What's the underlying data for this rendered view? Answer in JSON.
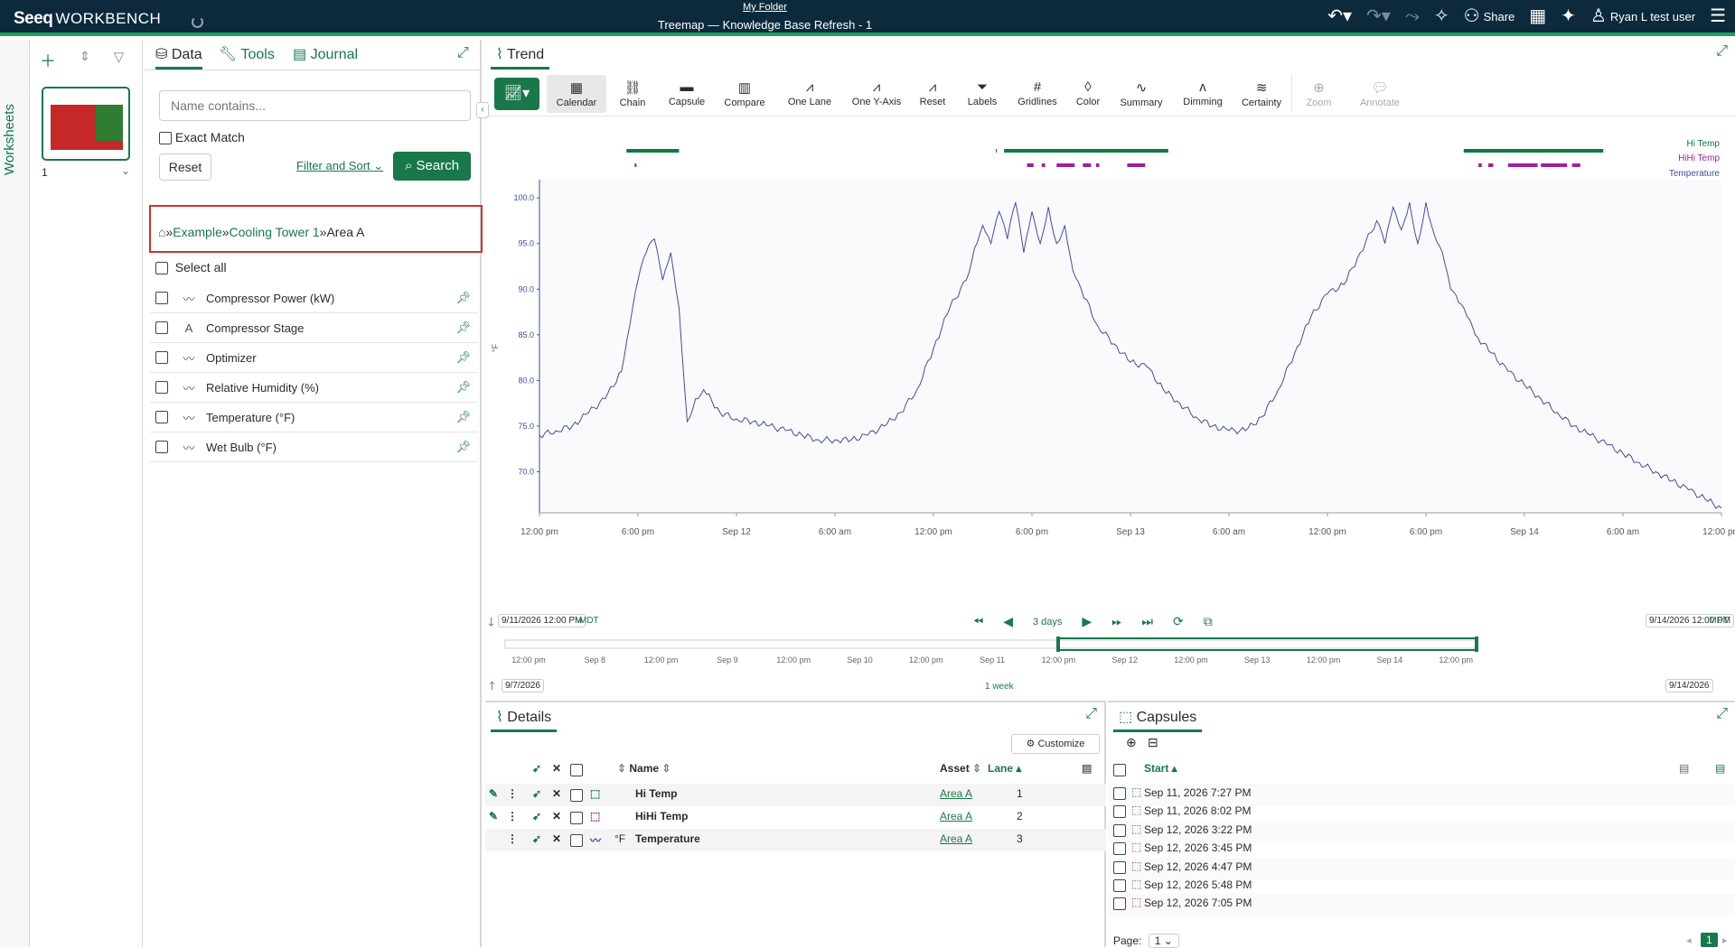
{
  "header": {
    "logo": "Seeq",
    "product": "WORKBENCH",
    "folder": "My Folder",
    "title": "Treemap — Knowledge Base Refresh - 1",
    "share_label": "Share",
    "user_name": "Ryan L test user"
  },
  "worksheets": {
    "rail_label": "Worksheets",
    "number": "1"
  },
  "data_panel": {
    "tabs": [
      "Data",
      "Tools",
      "Journal"
    ],
    "search_placeholder": "Name contains...",
    "exact_match_label": "Exact Match",
    "reset_label": "Reset",
    "filter_sort_label": "Filter and Sort",
    "search_label": "Search",
    "breadcrumb": {
      "sep": "»",
      "level1": "Example",
      "level2": "Cooling Tower 1",
      "current": "Area A"
    },
    "select_all_label": "Select all",
    "items": [
      {
        "label": "Compressor Power (kW)",
        "icon": "signal-icon"
      },
      {
        "label": "Compressor Stage",
        "icon": "string-signal-icon"
      },
      {
        "label": "Optimizer",
        "icon": "signal-icon"
      },
      {
        "label": "Relative Humidity (%)",
        "icon": "signal-icon"
      },
      {
        "label": "Temperature (°F)",
        "icon": "signal-icon"
      },
      {
        "label": "Wet Bulb (°F)",
        "icon": "signal-icon"
      }
    ]
  },
  "trend": {
    "tab_label": "Trend",
    "tools": [
      "Calendar",
      "Chain",
      "Capsule",
      "Compare",
      "One Lane",
      "One Y-Axis",
      "Reset",
      "Labels",
      "Gridlines",
      "Color",
      "Summary",
      "Dimming",
      "Certainty",
      "Zoom",
      "Annotate"
    ],
    "display_start": "9/11/2026 12:00 PM",
    "display_end": "9/14/2026 12:00 PM",
    "timezone": "MDT",
    "display_range": "3 days",
    "investigate_start": "9/7/2026",
    "investigate_end": "9/14/2026",
    "investigate_range": "1 week",
    "overview_ticks": [
      "12:00 pm",
      "Sep 8",
      "12:00 pm",
      "Sep 9",
      "12:00 pm",
      "Sep 10",
      "12:00 pm",
      "Sep 11",
      "12:00 pm",
      "Sep 12",
      "12:00 pm",
      "Sep 13",
      "12:00 pm",
      "Sep 14",
      "12:00 pm"
    ]
  },
  "chart_data": {
    "type": "line",
    "ylabel": "°F",
    "ylim": [
      65.5,
      101.5
    ],
    "yticks": [
      "100.0",
      "95.0",
      "90.0",
      "85.0",
      "80.0",
      "75.0",
      "70.0"
    ],
    "xticks": [
      "12:00 pm",
      "6:00 pm",
      "Sep 12",
      "6:00 am",
      "12:00 pm",
      "6:00 pm",
      "Sep 13",
      "6:00 am",
      "12:00 pm",
      "6:00 pm",
      "Sep 14",
      "6:00 am",
      "12:00 pm"
    ],
    "x_unit": "hours from 9/11/2026 12:00 PM",
    "series": [
      {
        "name": "Temperature",
        "color": "#3f4ea0",
        "x": [
          0,
          1,
          2,
          3,
          4,
          5,
          5.5,
          6,
          6.5,
          7,
          7.5,
          8,
          8.5,
          9,
          9.5,
          10,
          11,
          12,
          13,
          14,
          15,
          16,
          17,
          18,
          19,
          20,
          21,
          22,
          23,
          24,
          25,
          26,
          26.5,
          27,
          27.5,
          28,
          28.5,
          29,
          29.5,
          30,
          30.5,
          31,
          31.5,
          32,
          32.5,
          33,
          34,
          35,
          36,
          37,
          38,
          39,
          40,
          41,
          42,
          43,
          44,
          45,
          46,
          47,
          48,
          49,
          50,
          51,
          51.5,
          52,
          52.5,
          53,
          53.5,
          54,
          54.5,
          55,
          55.5,
          56,
          56.5,
          57,
          58,
          59,
          60,
          61,
          62,
          63,
          64,
          65,
          66,
          67,
          68,
          69,
          70,
          71,
          72
        ],
        "values": [
          74.0,
          74.5,
          75.0,
          76.5,
          78.0,
          81.0,
          86.0,
          91.0,
          94.0,
          95.5,
          91.0,
          94.0,
          88.0,
          75.5,
          78.0,
          79.0,
          76.5,
          75.8,
          75.5,
          75.0,
          74.5,
          74.0,
          73.5,
          73.5,
          73.5,
          74.0,
          75.0,
          76.5,
          79.0,
          83.5,
          88.0,
          91.0,
          94.5,
          97.0,
          95.0,
          98.5,
          95.5,
          99.5,
          94.0,
          98.5,
          95.0,
          99.0,
          95.0,
          97.0,
          92.0,
          90.0,
          86.0,
          84.0,
          82.0,
          81.5,
          79.0,
          77.5,
          76.0,
          75.0,
          74.5,
          74.5,
          76.0,
          79.0,
          83.0,
          87.0,
          89.5,
          90.5,
          94.0,
          97.5,
          95.0,
          99.0,
          96.5,
          99.5,
          95.0,
          99.5,
          96.0,
          94.0,
          90.0,
          88.5,
          87.0,
          85.0,
          83.0,
          81.0,
          79.5,
          78.0,
          76.5,
          75.0,
          74.0,
          73.0,
          72.0,
          71.0,
          70.0,
          69.0,
          68.0,
          67.0,
          66.0
        ]
      },
      {
        "name": "Hi Temp",
        "color": "#0a7a3e"
      },
      {
        "name": "HiHi Temp",
        "color": "#a0209a"
      }
    ],
    "capsules": {
      "hi_temp": [
        [
          5.3,
          8.5
        ],
        [
          28.3,
          38.3
        ],
        [
          56.3,
          64.8
        ]
      ],
      "hihi_temp": [
        [
          5.8,
          5.9
        ],
        [
          29.7,
          30.1
        ],
        [
          30.6,
          30.8
        ],
        [
          31.5,
          32.6
        ],
        [
          33.1,
          33.6
        ],
        [
          33.9,
          34.1
        ],
        [
          35.8,
          36.9
        ],
        [
          57.2,
          57.4
        ],
        [
          57.8,
          58.1
        ],
        [
          59.0,
          60.8
        ],
        [
          61.0,
          62.6
        ],
        [
          62.9,
          63.4
        ]
      ]
    }
  },
  "details": {
    "tab_label": "Details",
    "customize_label": "Customize",
    "columns": {
      "name": "Name",
      "asset": "Asset",
      "lane": "Lane"
    },
    "rows": [
      {
        "name": "Hi Temp",
        "asset": "Area A",
        "lane": "1",
        "unit": "",
        "color": "#0a7a3e"
      },
      {
        "name": "HiHi Temp",
        "asset": "Area A",
        "lane": "2",
        "unit": "",
        "color": "#a0209a"
      },
      {
        "name": "Temperature",
        "asset": "Area A",
        "lane": "3",
        "unit": "°F",
        "color": "#3f4ea0"
      }
    ]
  },
  "capsules_panel": {
    "tab_label": "Capsules",
    "start_label": "Start",
    "rows": [
      {
        "start": "Sep 11, 2026 7:27 PM",
        "color": "#0a7a3e"
      },
      {
        "start": "Sep 11, 2026 8:02 PM",
        "color": "#a0209a"
      },
      {
        "start": "Sep 12, 2026 3:22 PM",
        "color": "#0a7a3e"
      },
      {
        "start": "Sep 12, 2026 3:45 PM",
        "color": "#a0209a"
      },
      {
        "start": "Sep 12, 2026 4:47 PM",
        "color": "#a0209a"
      },
      {
        "start": "Sep 12, 2026 5:48 PM",
        "color": "#a0209a"
      },
      {
        "start": "Sep 12, 2026 7:05 PM",
        "color": "#a0209a"
      }
    ],
    "page_label": "Page:",
    "page_value": "1",
    "current_page": "1"
  }
}
